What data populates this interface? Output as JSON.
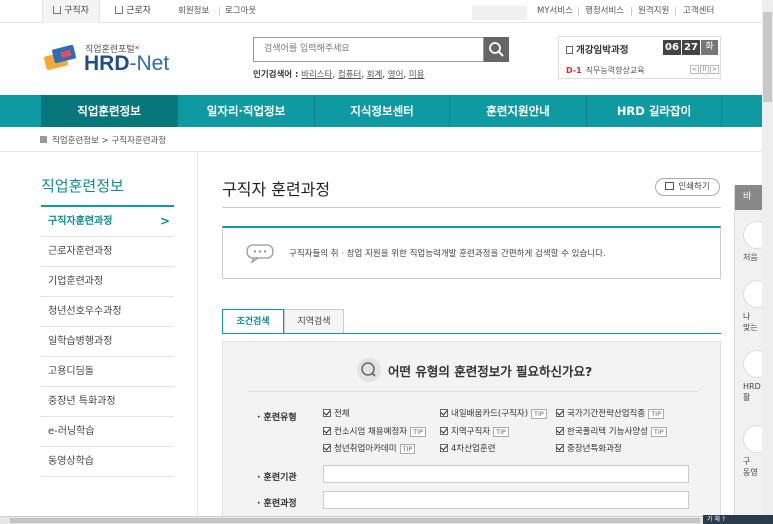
{
  "topbar": {
    "tab_jobseeker": "구직자",
    "tab_worker": "근로자",
    "join": "회원정보",
    "logout": "로그아웃",
    "links": [
      "MY서비스",
      "행정서비스",
      "원격지원",
      "고객센터"
    ]
  },
  "logo": {
    "sub": "직업훈련포털",
    "star": "*",
    "main": "HRD",
    "main_suffix": "-Net"
  },
  "search": {
    "placeholder": "검색어를 입력해주세요",
    "popular_label": "인기검색어 :",
    "popular_terms": [
      "바리스타",
      "컴퓨터",
      "회계",
      "영어",
      "미용"
    ]
  },
  "datebox": {
    "label": "개강임박과정",
    "month": "06",
    "day": "27",
    "weekday": "화",
    "dday": "D-1",
    "course": "직무능력향상교육",
    "prev": "<",
    "pause": "ll",
    "next": ">"
  },
  "nav": [
    "직업훈련정보",
    "일자리·직업정보",
    "지식정보센터",
    "훈련지원안내",
    "HRD 길라잡이"
  ],
  "breadcrumb": "직업훈련정보 > 구직자훈련과정",
  "sidebar": {
    "title": "직업훈련정보",
    "items": [
      "구직자훈련과정",
      "근로자훈련과정",
      "기업훈련과정",
      "청년선호우수과정",
      "일학습병행과정",
      "고용디딤돌",
      "중장년 특화과정",
      "e-러닝학습",
      "동영상학습"
    ],
    "active_arrow": ">"
  },
  "content": {
    "title": "구직자 훈련과정",
    "print": "인쇄하기",
    "info": "구직자들의 취 · 창업 지원을 위한 직업능력개발 훈련과정을 간편하게 검색할 수 있습니다.",
    "tabs": [
      "조건검색",
      "지역검색"
    ],
    "question": "어떤 유형의 훈련정보가 필요하신가요?",
    "field_type": "· 훈련유형",
    "field_org": "· 훈련기관",
    "field_course": "· 훈련과정",
    "checkboxes": [
      {
        "label": "전체",
        "tip": ""
      },
      {
        "label": "내일배움카드(구직자)",
        "tip": "TIP"
      },
      {
        "label": "국가기간전략산업직종",
        "tip": "TIP"
      },
      {
        "label": "컨소시엄 채용예정자",
        "tip": "TIP"
      },
      {
        "label": "지역구직자",
        "tip": "TIP"
      },
      {
        "label": "한국폴리텍 기능사양성",
        "tip": "TIP"
      },
      {
        "label": "청년취업아카데미",
        "tip": "TIP"
      },
      {
        "label": "4차산업훈련",
        "tip": ""
      },
      {
        "label": "중장년특화과정",
        "tip": ""
      }
    ]
  },
  "rightfloat": {
    "head": "바",
    "items": [
      "처음",
      "나\n맞는",
      "HRD\n활",
      "구\n동영"
    ]
  },
  "tray": "가 체 ?"
}
